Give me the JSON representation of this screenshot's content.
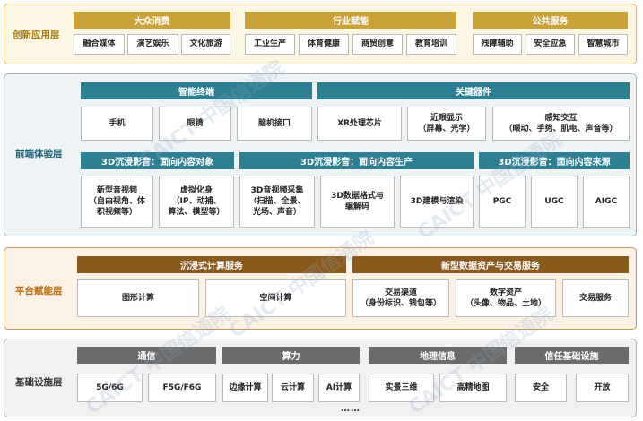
{
  "layers": {
    "innovation": {
      "label": "创新应用层",
      "groups": [
        {
          "header": "大众消费",
          "items": [
            "融合媒体",
            "演艺娱乐",
            "文化旅游"
          ]
        },
        {
          "header": "行业赋能",
          "items": [
            "工业生产",
            "体育健康",
            "商贸创意",
            "教育培训"
          ]
        },
        {
          "header": "公共服务",
          "items": [
            "残障辅助",
            "安全应急",
            "智慧城市"
          ]
        }
      ]
    },
    "frontend": {
      "label": "前端体验层",
      "top_headers": [
        "智能终端",
        "关键器件"
      ],
      "terminal_items": [
        "手机",
        "眼镜",
        "脑机接口"
      ],
      "component_items": [
        "XR处理芯片",
        "近眼显示\n（屏幕、光学）",
        "感知交互\n（眼动、手势、肌电、声音等）"
      ],
      "mid_headers": [
        "3D沉浸影音：面向内容对象",
        "3D沉浸影音：面向内容生产",
        "3D沉浸影音：面向内容来源"
      ],
      "object_items": [
        "新型音视频\n（自由视角、体\n积视频等）",
        "虚拟化身\n（IP、动捕、\n算法、模型等）"
      ],
      "production_items": [
        "3D音视频采集\n（扫描、全景、\n光场、声音）",
        "3D数据格式与\n编解码",
        "3D建模与渲染"
      ],
      "source_items": [
        "PGC",
        "UGC",
        "AIGC"
      ]
    },
    "platform": {
      "label": "平台赋能层",
      "headers": [
        "沉浸式计算服务",
        "新型数据资产与交易服务"
      ],
      "compute_items": [
        "图形计算",
        "空间计算"
      ],
      "trade_items": [
        "交易渠道\n（身份标识、钱包等）",
        "数字资产\n（头像、物品、土地）",
        "交易服务"
      ]
    },
    "infrastructure": {
      "label": "基础设施层",
      "groups": [
        {
          "header": "通信",
          "items": [
            "5G/6G",
            "F5G/F6G"
          ]
        },
        {
          "header": "算力",
          "items": [
            "边缘计算",
            "云计算",
            "AI计算"
          ]
        },
        {
          "header": "地理信息",
          "items": [
            "实景三维",
            "高精地图"
          ]
        },
        {
          "header": "信任基础设施",
          "items": [
            "安全",
            "开放"
          ]
        }
      ],
      "ellipsis": "……"
    }
  },
  "watermark": {
    "text": "CAICT 中国信通院"
  },
  "colors": {
    "innovation_bg": "#fcf7e3",
    "innovation_border": "#d6b85a",
    "innovation_label": "#a37a14",
    "frontend_bg": "#eef3f6",
    "frontend_border": "#9fb6c3",
    "frontend_label": "#1f5f73",
    "platform_bg": "#fbf1e4",
    "platform_border": "#c69a62",
    "platform_label": "#b86b10",
    "infrastructure_bg": "#f1f1f1",
    "infrastructure_border": "#b5b5b5",
    "infrastructure_label": "#333333"
  }
}
